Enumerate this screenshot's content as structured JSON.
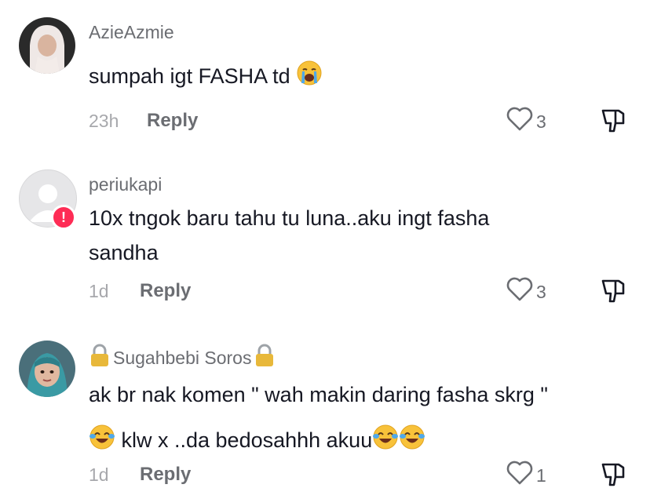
{
  "comments": [
    {
      "username": "AzieAzmie",
      "text_parts": [
        "sumpah igt FASHA td "
      ],
      "emoji": "crying-face",
      "time": "23h",
      "reply_label": "Reply",
      "likes": "3"
    },
    {
      "username": "periukapi",
      "text_line1": "10x tngok baru tahu tu luna..aku ingt fasha",
      "text_line2": "sandha",
      "time": "1d",
      "reply_label": "Reply",
      "likes": "3"
    },
    {
      "username": "Sugahbebi Soros",
      "text_line1": "ak br nak komen \" wah makin daring fasha skrg \"",
      "text_line2": " klw x ..da bedosahhh akuu",
      "emoji": "tears-of-joy-face",
      "time": "1d",
      "reply_label": "Reply",
      "likes": "1"
    }
  ],
  "colors": {
    "text": "#161823",
    "secondary": "#6b6d72",
    "timestamp": "#a7a8ac",
    "alert": "#fe2c55"
  }
}
